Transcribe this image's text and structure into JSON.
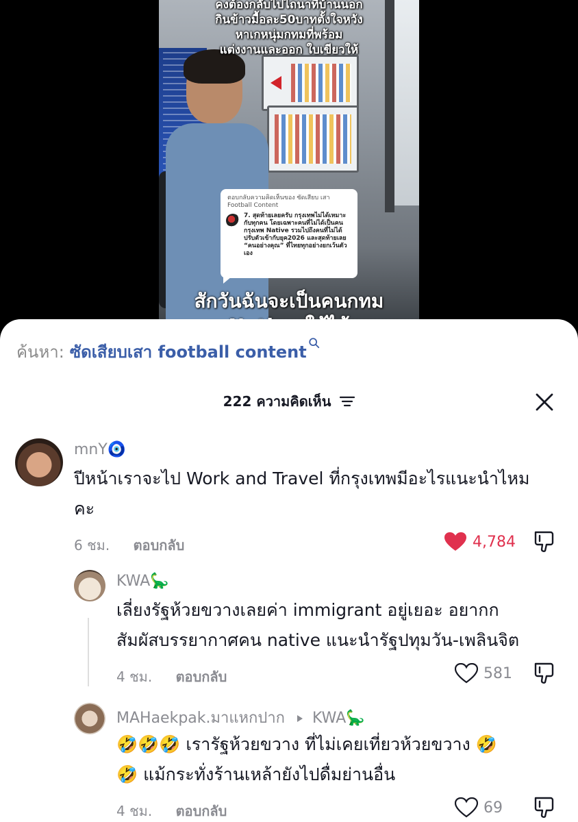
{
  "video": {
    "caption_top": "คงต้องกลับไปไถนาที่บ้านนอก\nกินข้าวมื้อละ50บาทตั้งใจหวัง\nหาเกหนุ่มกทมที่พร้อม\nแต่งงานและออก ใบเขียวให้",
    "reply_card": {
      "header": "ตอบกลับความคิดเห็นของ ซัดเสียบ เสา Football Content",
      "body": "7. สุดท้ายเลยครับ กรุงเทพไม่ได้เหมาะกับทุกคน โดยเฉพาะคนที่ไม่ได้เป็นคนกรุงเทพ Native รวมไปถึงคนที่ไม่ได้ปรับตัวเข้ากับยุค2026 และสุดท้ายเลย “คนอย่างคุณ” ที่ไทยทุกอย่างยกเว้นตัวเอง"
    },
    "caption_bottom": "สักวันฉันจะเป็นคนกทม",
    "caption_bottom2": "Native ให้ได้"
  },
  "search": {
    "label": "ค้นหา:",
    "query": "ซัดเสียบเสา football content"
  },
  "comments_header": {
    "count_title": "222 ความคิดเห็น"
  },
  "comments": [
    {
      "username": "mnY🧿",
      "text_line1": "ปีหน้าเราจะไป Work and Travel ที่กรุงเทพมีอะไรแนะนำไหม",
      "text_line2": "คะ",
      "time": "6 ชม.",
      "reply_label": "ตอบกลับ",
      "likes": "4,784",
      "liked": true
    },
    {
      "username": "KWA🦕",
      "text_line1": "เลี่ยงรัฐห้วยขวางเลยค่า immigrant อยู่เยอะ อยากก",
      "text_line2": "สัมผัสบรรยากาศคน native แนะนำรัฐปทุมวัน-เพลินจิต",
      "time": "4 ชม.",
      "reply_label": "ตอบกลับ",
      "likes": "581",
      "liked": false
    },
    {
      "username": "MAHaekpak.มาแหกปาก",
      "reply_to": "KWA🦕",
      "text_line1": "🤣🤣🤣 เรารัฐห้วยขวาง ที่ไม่เคยเที่ยวห้วยขวาง 🤣",
      "text_line2": "🤣 แม้กระทั่งร้านเหล้ายังไปดื่มย่านอื่น",
      "time": "4 ชม.",
      "reply_label": "ตอบกลับ",
      "likes": "69",
      "liked": false
    }
  ],
  "colors": {
    "like_active": "#e0314e",
    "search_query": "#3b5ea8",
    "muted": "#8a8b91"
  },
  "icons": [
    "search-icon",
    "filter-icon",
    "close-icon",
    "heart-icon",
    "dislike-icon",
    "play-triangle-icon"
  ]
}
